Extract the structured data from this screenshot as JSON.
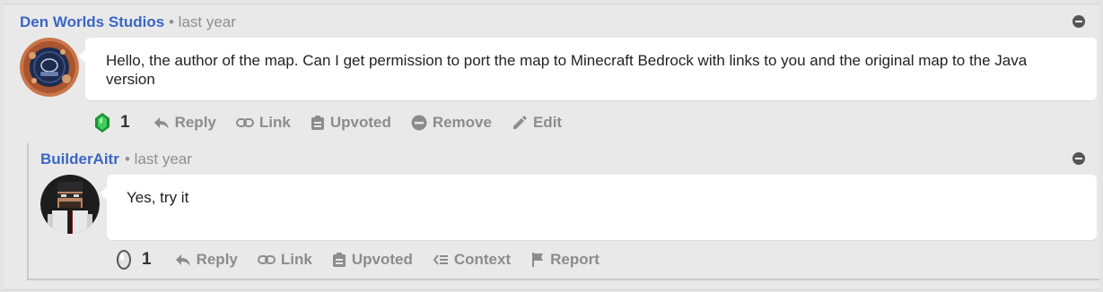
{
  "comment": {
    "author": "Den Worlds Studios",
    "time": "• last year",
    "text": "Hello, the author of the map. Can I get permission to port the map to Minecraft Bedrock with links to you and the original map to the Java version",
    "score": "1",
    "actions": {
      "reply": "Reply",
      "link": "Link",
      "upvoted": "Upvoted",
      "remove": "Remove",
      "edit": "Edit"
    }
  },
  "reply": {
    "author": "BuilderAitr",
    "time": "• last year",
    "text": "Yes, try it",
    "score": "1",
    "actions": {
      "reply": "Reply",
      "link": "Link",
      "upvoted": "Upvoted",
      "context": "Context",
      "report": "Report"
    }
  },
  "colors": {
    "author_link": "#3a66c4",
    "action_gray": "#8c8c8c",
    "bubble_bg": "#ffffff",
    "emerald": "#2dbb4a"
  },
  "icons": [
    "collapse-icon",
    "emerald-icon",
    "silver-gem-icon",
    "reply-icon",
    "link-icon",
    "clipboard-icon",
    "remove-icon",
    "edit-icon",
    "context-icon",
    "flag-icon"
  ]
}
